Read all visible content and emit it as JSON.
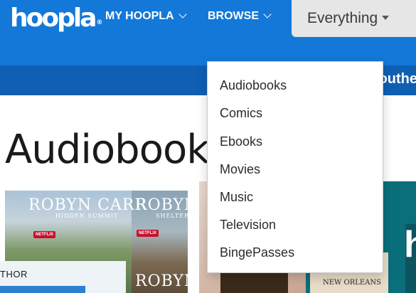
{
  "brand": {
    "logo_text": "hoopla",
    "trademark": "®",
    "primary_color": "#1478d8",
    "secondary_color": "#0f5fb3"
  },
  "nav": {
    "my_hoopla": "MY HOOPLA",
    "browse": "BROWSE",
    "search_scope": "Everything"
  },
  "banner": {
    "text": "outhe"
  },
  "page": {
    "title": "Audiobooks"
  },
  "dropdown": {
    "items": [
      {
        "label": "Audiobooks"
      },
      {
        "label": "Comics"
      },
      {
        "label": "Ebooks"
      },
      {
        "label": "Movies"
      },
      {
        "label": "Music"
      },
      {
        "label": "Television"
      },
      {
        "label": "BingePasses"
      }
    ]
  },
  "carousel": {
    "cover_1": {
      "author": "ROBYN CARR",
      "subtitle": "HIDDEN SUMMIT",
      "badge": "NETFLIX"
    },
    "cover_2": {
      "author_top": "ROBYN",
      "subtitle": "SHELTER MO",
      "author_bottom": "ROBYN",
      "badge": "NETFLIX"
    },
    "caption": "THOR",
    "cover_right_label": "NEW ORLEANS",
    "right_edge_letter": "h"
  }
}
